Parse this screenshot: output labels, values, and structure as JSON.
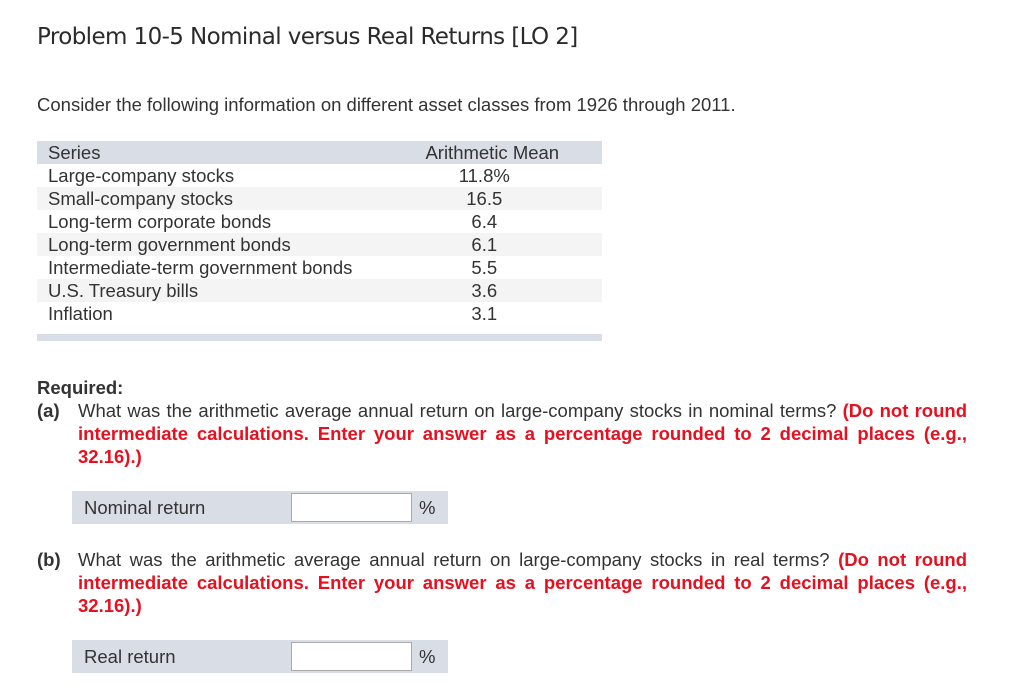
{
  "title": "Problem 10-5 Nominal versus Real Returns [LO 2]",
  "intro": "Consider the following information on different asset classes from 1926 through 2011.",
  "table": {
    "headers": [
      "Series",
      "Arithmetic Mean"
    ],
    "rows": [
      {
        "series": "Large-company stocks",
        "mean": "11.8%"
      },
      {
        "series": "Small-company stocks",
        "mean": "16.5"
      },
      {
        "series": "Long-term corporate bonds",
        "mean": "6.4"
      },
      {
        "series": "Long-term government bonds",
        "mean": "6.1"
      },
      {
        "series": "Intermediate-term government bonds",
        "mean": "5.5"
      },
      {
        "series": "U.S. Treasury bills",
        "mean": "3.6"
      },
      {
        "series": "Inflation",
        "mean": "3.1"
      }
    ]
  },
  "required_label": "Required:",
  "questions": [
    {
      "letter": "(a)",
      "text": "What was the arithmetic average annual return on large-company stocks in nominal terms?",
      "note": "(Do not round intermediate calculations. Enter your answer as a percentage rounded to 2 decimal places (e.g., 32.16).)",
      "answer_label": "Nominal return",
      "answer_value": "",
      "unit": "%"
    },
    {
      "letter": "(b)",
      "text": "What was the arithmetic average annual return on large-company stocks in real terms?",
      "note": "(Do not round intermediate calculations. Enter your answer as a percentage rounded to 2 decimal places (e.g., 32.16).)",
      "answer_label": "Real return",
      "answer_value": "",
      "unit": "%"
    }
  ],
  "colors": {
    "instruction_red": "#e8101f",
    "table_header_bg": "#d9dde6"
  }
}
